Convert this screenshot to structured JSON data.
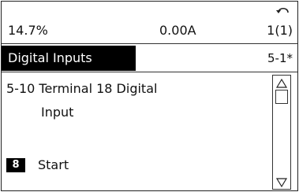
{
  "status": {
    "left_value": "14.7%",
    "mid_value": "0.00A",
    "right_value": "1(1)",
    "back_icon": "back-arrow-icon"
  },
  "menu": {
    "title": "Digital Inputs",
    "code": "5-1*"
  },
  "parameter": {
    "line1": "5-10 Terminal 18 Digital",
    "line2": "Input"
  },
  "value": {
    "index": "8",
    "label": "Start"
  },
  "scrollbar": {
    "up_icon": "scroll-up-arrow-icon",
    "down_icon": "scroll-down-arrow-icon"
  }
}
